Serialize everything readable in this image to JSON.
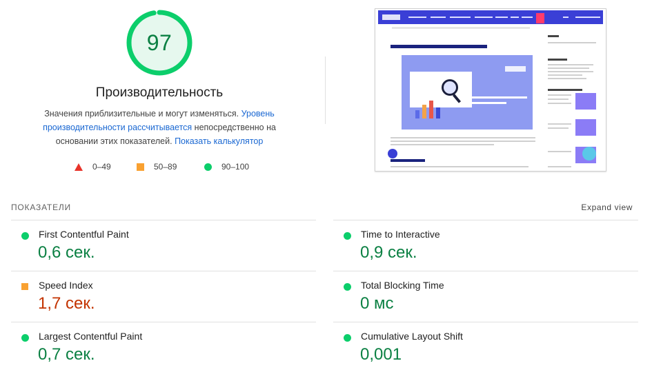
{
  "score": {
    "value": "97",
    "fraction": 0.97,
    "title": "Производительность",
    "desc_plain": "Значения приблизительные и могут изменяться.",
    "desc_link": "Уровень производительности рассчитывается",
    "desc_after": "непосредственно на основании этих показателей.",
    "calc_link": "Показать калькулятор",
    "ring_color": "#0cce6b",
    "text_color": "#0b8043",
    "bg_color": "#e6f8ee"
  },
  "legend": [
    {
      "icon": "red-triangle",
      "label": "0–49"
    },
    {
      "icon": "orange-square",
      "label": "50–89"
    },
    {
      "icon": "green-circle",
      "label": "90–100"
    }
  ],
  "metrics_section": {
    "label": "ПОКАЗАТЕЛИ",
    "expand": "Expand view"
  },
  "metrics": {
    "fcp": {
      "name": "First Contentful Paint",
      "value": "0,6 сек.",
      "status": "good"
    },
    "tti": {
      "name": "Time to Interactive",
      "value": "0,9 сек.",
      "status": "good"
    },
    "si": {
      "name": "Speed Index",
      "value": "1,7 сек.",
      "status": "average"
    },
    "tbt": {
      "name": "Total Blocking Time",
      "value": "0 мс",
      "status": "good"
    },
    "lcp": {
      "name": "Largest Contentful Paint",
      "value": "0,7 сек.",
      "status": "good"
    },
    "cls": {
      "name": "Cumulative Layout Shift",
      "value": "0,001",
      "status": "good"
    }
  },
  "colors": {
    "good": "#0cce6b",
    "average": "#f9a131",
    "poor": "#e8332a",
    "link": "#1967d2"
  }
}
